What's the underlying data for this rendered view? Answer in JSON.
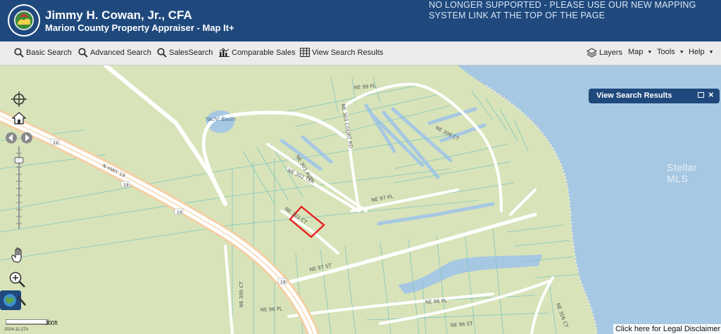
{
  "header": {
    "title": "Jimmy H. Cowan, Jr., CFA",
    "subtitle": "Marion County Property Appraiser - Map It+",
    "notice": "NO LONGER SUPPORTED - PLEASE USE OUR NEW MAPPING SYSTEM LINK AT THE TOP OF THE PAGE",
    "logo_text": "PROPERTY APPRAISER"
  },
  "toolbar": {
    "basic_search": "Basic Search",
    "advanced_search": "Advanced Search",
    "sales_search": "SalesSearch",
    "comparable_sales": "Comparable Sales",
    "view_search_results": "View Search Results",
    "layers": "Layers",
    "map": "Map",
    "tools": "Tools",
    "help": "Help"
  },
  "panel": {
    "title": "View Search Results"
  },
  "map": {
    "street_labels": {
      "ne99pl": "NE 99 PL",
      "ne303court": "NE 303 COURT RD",
      "ne306ct_top": "NE 306 CT",
      "ne303ave": "NE 303 AVE",
      "ne302ter": "NE 302 TER",
      "ne97pl": "NE 97 PL",
      "nhwy19": "N HWY 19",
      "hwy19a": "19",
      "hwy19b": "19",
      "hwy19c": "19",
      "hwy19d": "19",
      "ne301ct": "NE 301 CT",
      "ne97st": "NE 97 ST",
      "ne300ct": "NE 300 CT",
      "ne96pl": "NE 96 PL",
      "ne96pl2": "NE 96 PL",
      "ne96st": "NE 96 ST",
      "ne306ct_bot": "NE 306 CT",
      "yacht_basin": "Yacht Basin"
    },
    "scale_label": "300ft",
    "legal_link": "Click here for Legal Disclaimer",
    "watermark": "Stellar MLS",
    "datestamp": "2024-11-27A"
  },
  "colors": {
    "header_bg": "#1f497d",
    "land": "#d8e3b9",
    "water": "#a7c8e3",
    "parcel_lines": "#7fc7bf",
    "roads": "#ffffff",
    "selected_parcel": "#e8201f"
  }
}
